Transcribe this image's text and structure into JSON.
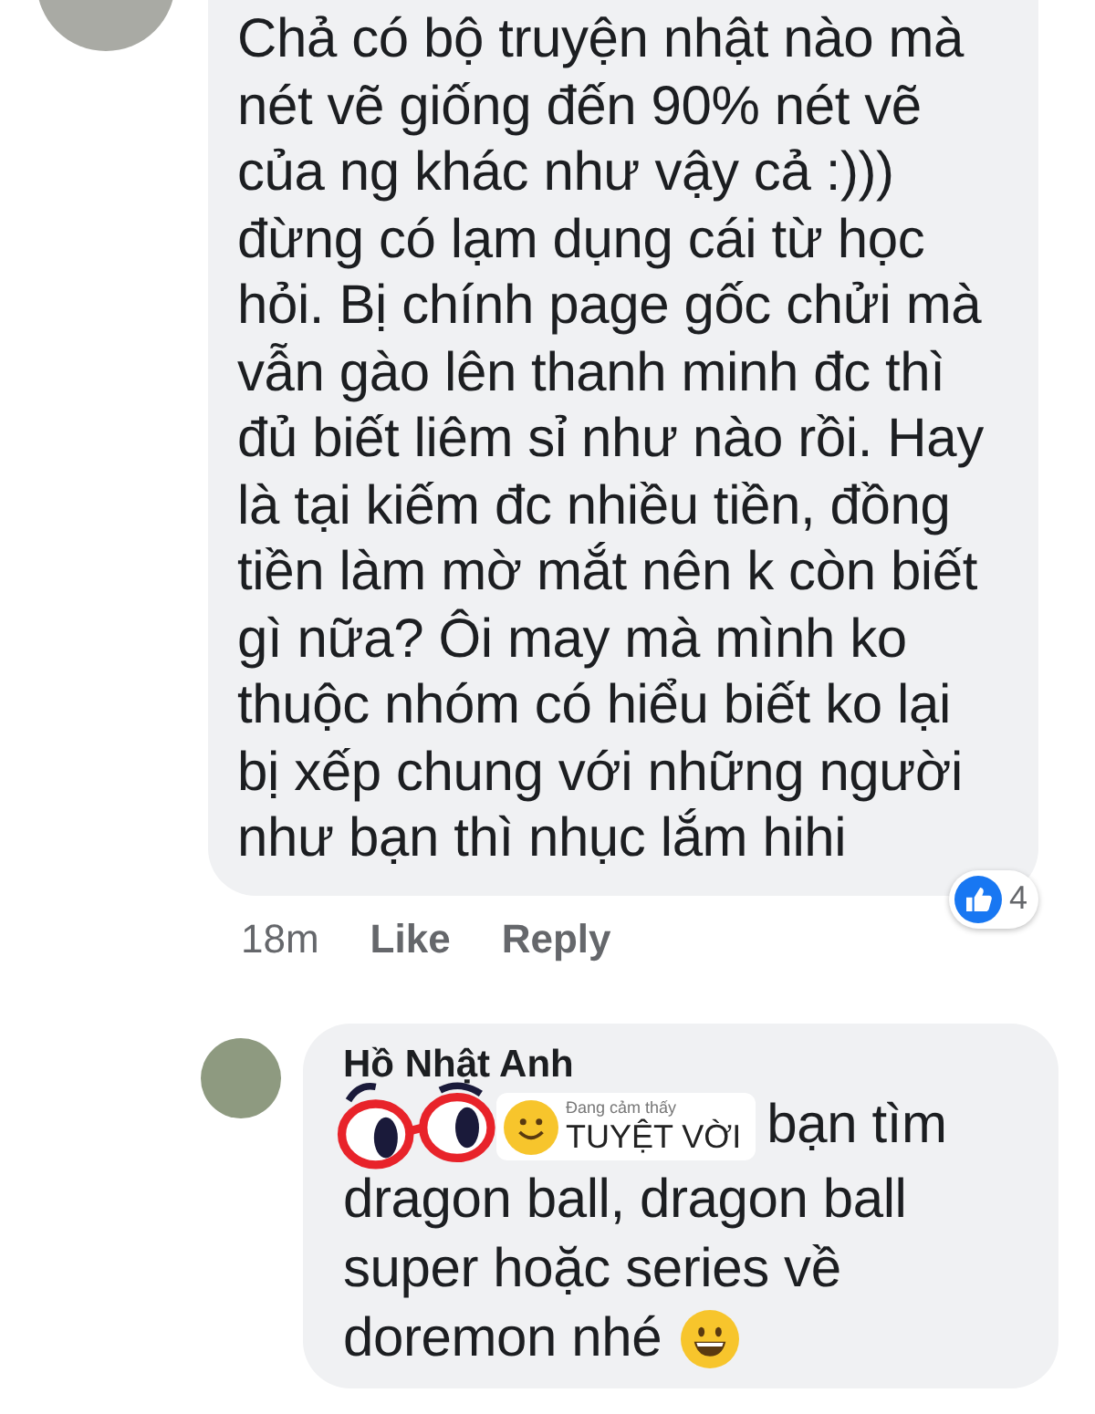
{
  "comment": {
    "text": "Chả có bộ truyện nhật nào mà\nnét vẽ giống đến 90% nét vẽ\ncủa ng khác như vậy cả :)))\nđừng có lạm dụng cái từ học\nhỏi. Bị chính page gốc chửi mà\nvẫn gào lên thanh minh đc thì\nđủ biết liêm sỉ như nào rồi. Hay\nlà tại kiếm đc nhiều tiền, đồng\ntiền làm mờ mắt nên k còn biết\ngì nữa? Ôi may mà mình ko\nthuộc nhóm có hiểu biết ko lại\nbị xếp chung với những người\nnhư bạn thì nhục lắm hihi",
    "time": "18m",
    "actions": [
      "Like",
      "Reply"
    ],
    "reaction_count": "4"
  },
  "reply": {
    "author": "Hồ Nhật Anh",
    "sticker": {
      "caption": "Đang cảm thấy",
      "feeling": "TUYỆT VỜI"
    },
    "first_line": "bạn tìm",
    "lines": [
      "dragon ball, dragon ball",
      "super hoặc series về",
      "doremon nhé"
    ]
  }
}
